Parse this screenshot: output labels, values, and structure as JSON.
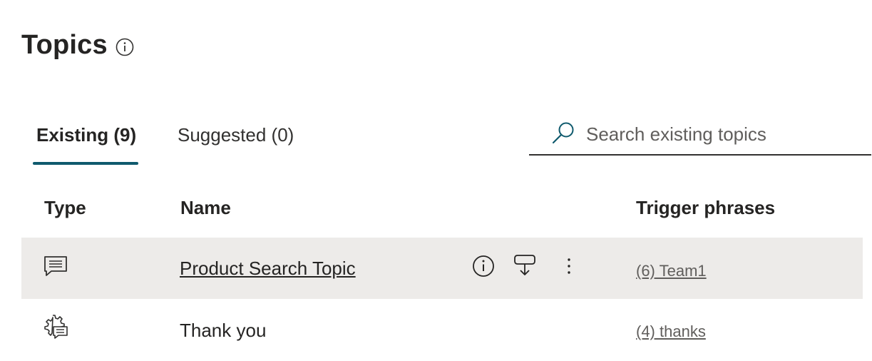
{
  "header": {
    "title": "Topics",
    "info_icon": "info-icon"
  },
  "tabs": [
    {
      "label": "Existing (9)",
      "selected": true
    },
    {
      "label": "Suggested (0)",
      "selected": false
    }
  ],
  "search": {
    "placeholder": "Search existing topics",
    "value": "",
    "icon": "search-icon"
  },
  "table": {
    "columns": [
      "Type",
      "Name",
      "Trigger phrases"
    ],
    "rows": [
      {
        "type_icon": "chat-message-icon",
        "name": "Product Search Topic",
        "trigger": "(6) Team1",
        "selected": true,
        "actions": [
          "info-icon",
          "test-topic-icon",
          "more-options-icon"
        ]
      },
      {
        "type_icon": "system-topic-icon",
        "name": "Thank you",
        "trigger": "(4) thanks",
        "selected": false
      }
    ]
  },
  "colors": {
    "accent": "#0f5a6d",
    "selected_row": "#edebe9",
    "text": "#252423",
    "secondary_text": "#605e5c"
  }
}
